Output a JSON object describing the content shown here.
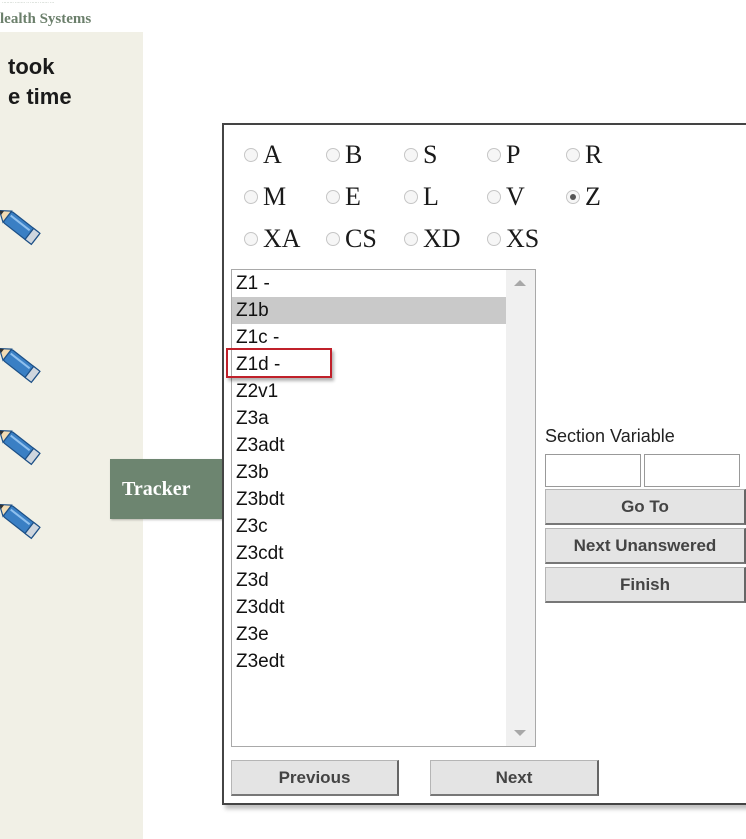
{
  "brand": {
    "tagline": "········ ······· ·· ······ ······ ···",
    "name": "Health Systems",
    "visible_name": "lealth Systems"
  },
  "sidebar": {
    "heading_line1": "took",
    "heading_line2": "e time"
  },
  "tracker": {
    "tab_label": "Tracker"
  },
  "sections": {
    "radios": [
      {
        "label": "A",
        "checked": false
      },
      {
        "label": "B",
        "checked": false
      },
      {
        "label": "S",
        "checked": false
      },
      {
        "label": "P",
        "checked": false
      },
      {
        "label": "R",
        "checked": false
      },
      {
        "label": "M",
        "checked": false
      },
      {
        "label": "E",
        "checked": false
      },
      {
        "label": "L",
        "checked": false
      },
      {
        "label": "V",
        "checked": false
      },
      {
        "label": "Z",
        "checked": true
      },
      {
        "label": "XA",
        "checked": false
      },
      {
        "label": "CS",
        "checked": false
      },
      {
        "label": "XD",
        "checked": false
      },
      {
        "label": "XS",
        "checked": false
      }
    ]
  },
  "variables": {
    "items": [
      "Z1 -",
      "Z1b",
      "Z1c -",
      "Z1d -",
      "Z2v1",
      "Z3a",
      "Z3adt",
      "Z3b",
      "Z3bdt",
      "Z3c",
      "Z3cdt",
      "Z3d",
      "Z3ddt",
      "Z3e",
      "Z3edt"
    ],
    "selected": "Z1b",
    "highlighted": "Z1d -"
  },
  "goto": {
    "label": "Section Variable",
    "section_value": "",
    "variable_value": "",
    "go_to_label": "Go To",
    "next_unanswered_label": "Next Unanswered",
    "finish_label": "Finish"
  },
  "nav": {
    "previous_label": "Previous",
    "next_label": "Next"
  },
  "colors": {
    "sidebar_bg": "#f1f0e6",
    "tracker_tab": "#6d8570",
    "highlight_border": "#c0202a",
    "selected_row": "#c9c9c9"
  }
}
